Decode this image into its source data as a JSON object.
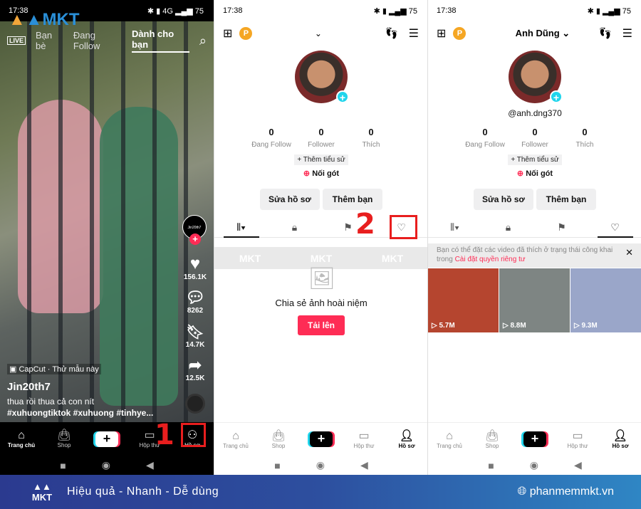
{
  "colors": {
    "accent": "#fe2c55",
    "cyan": "#20d5ec",
    "annotation": "#e81e1e",
    "footer_start": "#2b3a8f",
    "footer_end": "#2f86c4"
  },
  "status": {
    "time": "17:38",
    "battery": "75",
    "network": "4G"
  },
  "feed": {
    "tabs": {
      "live": "LIVE",
      "friends": "Bạn bè",
      "following": "Đang Follow",
      "for_you": "Dành cho bạn"
    },
    "creator_avatar_label": "Jin20th7",
    "likes": "156.1K",
    "comments": "8262",
    "saves": "14.7K",
    "shares": "12.5K",
    "capcut": "CapCut · Thử mẫu này",
    "username": "Jin20th7",
    "caption": "thua rồi thua cả con nít",
    "hashtags": "#xuhuongtiktok #xuhuong #tinhye..."
  },
  "nav": {
    "home": "Trang chủ",
    "shop": "Shop",
    "inbox": "Hộp thư",
    "profile": "Hồ sơ"
  },
  "profile": {
    "name": "Anh Dũng",
    "handle": "@anh.dng370",
    "following_count": "0",
    "following_label": "Đang Follow",
    "followers_count": "0",
    "followers_label": "Follower",
    "likes_count": "0",
    "likes_label": "Thích",
    "add_bio": "+ Thêm tiểu sử",
    "noi_got": "Nối gót",
    "edit_profile": "Sửa hồ sơ",
    "add_friends": "Thêm bạn",
    "empty_title": "Chia sẻ ảnh hoài niệm",
    "upload": "Tải lên",
    "notice": "Bạn có thể đặt các video đã thích ở trạng thái công khai trong ",
    "notice_link": "Cài đặt quyền riêng tư",
    "videos": [
      {
        "views": "5.7M",
        "color": "#b5452f"
      },
      {
        "views": "8.8M",
        "color": "#7e8583"
      },
      {
        "views": "9.3M",
        "color": "#9aa6c9"
      }
    ]
  },
  "annotations": {
    "step1": "1",
    "step2": "2"
  },
  "watermark": "MKT",
  "footer": {
    "slogan": "Hiệu quả - Nhanh - Dễ dùng",
    "website": "phanmemmkt.vn",
    "logo": "MKT"
  }
}
